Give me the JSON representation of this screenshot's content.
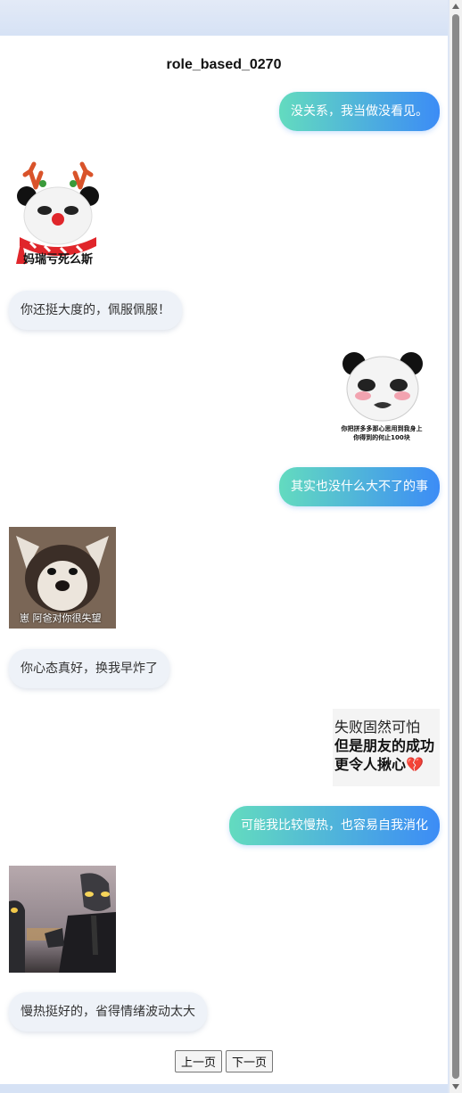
{
  "title": "role_based_0270",
  "messages": {
    "m1": "没关系，我当做没看见。",
    "m2_caption": "妈瑞亏死么斯",
    "m3": "你还挺大度的，佩服佩服！",
    "m4_caption_1": "你把拼多多那心思用到我身上",
    "m4_caption_2": "你得到的何止100块",
    "m5": "其实也没什么大不了的事",
    "m6_caption": "崽 阿爸对你很失望",
    "m7": "你心态真好，换我早炸了",
    "m8_line1": "失败固然可怕",
    "m8_line2": "但是朋友的成功",
    "m8_line3": "更令人揪心💔",
    "m9": "可能我比较慢热，也容易自我消化",
    "m11": "慢热挺好的，省得情绪波动太大"
  },
  "pager": {
    "prev": "上一页",
    "next": "下一页"
  },
  "colors": {
    "outgoing_start": "#63dbbf",
    "outgoing_end": "#3c8cf6",
    "incoming_bg": "#eef2f8"
  }
}
